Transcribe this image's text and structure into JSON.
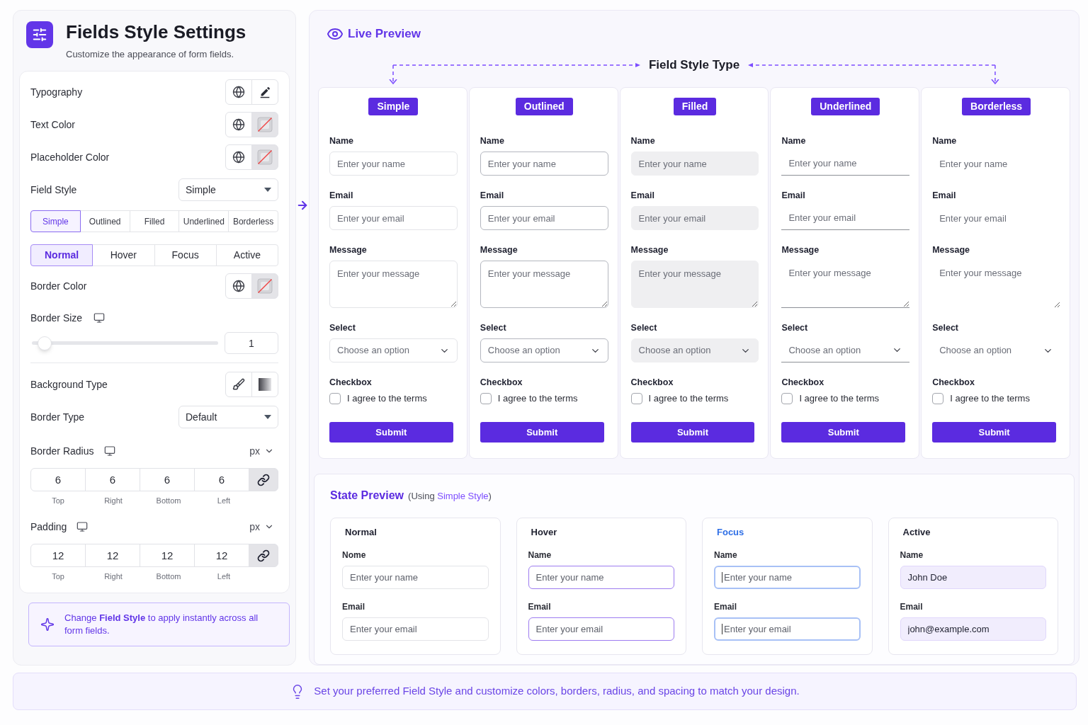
{
  "settings": {
    "title": "Fields Style Settings",
    "subtitle": "Customize the appearance of form fields.",
    "rows": [
      {
        "kind": "typography",
        "label": "Typography"
      },
      {
        "kind": "color",
        "label": "Text Color"
      },
      {
        "kind": "color",
        "label": "Placeholder Color"
      },
      {
        "kind": "select",
        "label": "Field Style",
        "value": "Simple"
      },
      {
        "kind": "segmented",
        "options": [
          {
            "label": "Simple",
            "selected": true
          },
          {
            "label": "Outlined",
            "selected": false
          },
          {
            "label": "Filled",
            "selected": false
          },
          {
            "label": "Underlined",
            "selected": false
          },
          {
            "label": "Borderless",
            "selected": false
          }
        ]
      },
      {
        "kind": "tabs",
        "options": [
          {
            "label": "Normal",
            "selected": true
          },
          {
            "label": "Hover",
            "selected": false
          },
          {
            "label": "Focus",
            "selected": false
          },
          {
            "label": "Active",
            "selected": false
          }
        ]
      },
      {
        "kind": "color",
        "label": "Border Color"
      },
      {
        "kind": "slider",
        "label": "Border Size",
        "level": 0.07,
        "value": "1"
      },
      {
        "kind": "background",
        "label": "Background Type"
      },
      {
        "kind": "select",
        "label": "Border Type",
        "value": "Default"
      },
      {
        "kind": "dimensions",
        "label": "Border Radius",
        "unit": "px",
        "linked": true,
        "sides": [
          {
            "value": "6",
            "label": "Top"
          },
          {
            "value": "6",
            "label": "Right"
          },
          {
            "value": "6",
            "label": "Bottom"
          },
          {
            "value": "6",
            "label": "Left"
          }
        ]
      },
      {
        "kind": "dimensions",
        "label": "Padding",
        "unit": "px",
        "linked": true,
        "sides": [
          {
            "value": "12",
            "label": "Top"
          },
          {
            "value": "12",
            "label": "Right"
          },
          {
            "value": "12",
            "label": "Bottom"
          },
          {
            "value": "12",
            "label": "Left"
          }
        ]
      }
    ],
    "tip": "Change **Field Style** to apply instantly across all form fields."
  },
  "preview": {
    "title": "Live Preview",
    "heading": "Field Style Type",
    "columns": [
      {
        "kind": "simple",
        "tag": "Simple",
        "fields": [
          {
            "kind": "input",
            "label": "Name",
            "placeholder": "Enter your name"
          },
          {
            "kind": "input",
            "label": "Email",
            "placeholder": "Enter your email"
          },
          {
            "kind": "textarea",
            "label": "Message",
            "placeholder": "Enter your message"
          },
          {
            "kind": "select",
            "label": "Select",
            "placeholder": "Choose an option"
          },
          {
            "kind": "checkbox",
            "label": "Checkbox",
            "text": "I agree to the terms",
            "checked": false
          }
        ],
        "button": "Submit"
      },
      {
        "kind": "outlined",
        "tag": "Outlined",
        "fields": [
          {
            "kind": "input",
            "label": "Name",
            "placeholder": "Enter your name"
          },
          {
            "kind": "input",
            "label": "Email",
            "placeholder": "Enter your email"
          },
          {
            "kind": "textarea",
            "label": "Message",
            "placeholder": "Enter your message"
          },
          {
            "kind": "select",
            "label": "Select",
            "placeholder": "Choose an option"
          },
          {
            "kind": "checkbox",
            "label": "Checkbox",
            "text": "I agree to the terms",
            "checked": false
          }
        ],
        "button": "Submit"
      },
      {
        "kind": "filled",
        "tag": "Filled",
        "fields": [
          {
            "kind": "input",
            "label": "Name",
            "placeholder": "Enter your name"
          },
          {
            "kind": "input",
            "label": "Email",
            "placeholder": "Enter your email"
          },
          {
            "kind": "textarea",
            "label": "Message",
            "placeholder": "Enter your message"
          },
          {
            "kind": "select",
            "label": "Select",
            "placeholder": "Choose an option"
          },
          {
            "kind": "checkbox",
            "label": "Checkbox",
            "text": "I agree to the terms",
            "checked": false
          }
        ],
        "button": "Submit"
      },
      {
        "kind": "underlined",
        "tag": "Underlined",
        "fields": [
          {
            "kind": "input",
            "label": "Name",
            "placeholder": "Enter your name"
          },
          {
            "kind": "input",
            "label": "Email",
            "placeholder": "Enter your email"
          },
          {
            "kind": "textarea",
            "label": "Message",
            "placeholder": "Enter your message"
          },
          {
            "kind": "select",
            "label": "Select",
            "placeholder": "Choose an option"
          },
          {
            "kind": "checkbox",
            "label": "Checkbox",
            "text": "I agree to the terms",
            "checked": false
          }
        ],
        "button": "Submit"
      },
      {
        "kind": "borderless",
        "tag": "Borderless",
        "fields": [
          {
            "kind": "input",
            "label": "Name",
            "placeholder": "Enter your name"
          },
          {
            "kind": "input",
            "label": "Email",
            "placeholder": "Enter your email"
          },
          {
            "kind": "textarea",
            "label": "Message",
            "placeholder": "Enter your message"
          },
          {
            "kind": "select",
            "label": "Select",
            "placeholder": "Choose an option"
          },
          {
            "kind": "checkbox",
            "label": "Checkbox",
            "text": "I agree to the terms",
            "checked": false
          }
        ],
        "button": "Submit"
      }
    ]
  },
  "state_preview": {
    "title": "State Preview",
    "note": {
      "before": "(Using ",
      "link": "Simple Style",
      "after": ")"
    },
    "cards": [
      {
        "kind": "normal",
        "title": "Normal",
        "fields": [
          {
            "label": "Nome",
            "placeholder": "Enter your name"
          },
          {
            "label": "Email",
            "placeholder": "Enter your email"
          }
        ]
      },
      {
        "kind": "hover",
        "title": "Hover",
        "fields": [
          {
            "label": "Name",
            "placeholder": "Enter your name"
          },
          {
            "label": "Email",
            "placeholder": "Enter your email"
          }
        ]
      },
      {
        "kind": "focus",
        "title": "Focus",
        "fields": [
          {
            "label": "Name",
            "placeholder": "Enter your name"
          },
          {
            "label": "Email",
            "placeholder": "Enter your email"
          }
        ]
      },
      {
        "kind": "active",
        "title": "Active",
        "fields": [
          {
            "label": "Name",
            "value": "John Doe"
          },
          {
            "label": "Email",
            "value": "john@example.com"
          }
        ]
      }
    ]
  },
  "footer": {
    "text": "Set your preferred Field Style and customize colors, borders, radius, and spacing to match your design."
  }
}
